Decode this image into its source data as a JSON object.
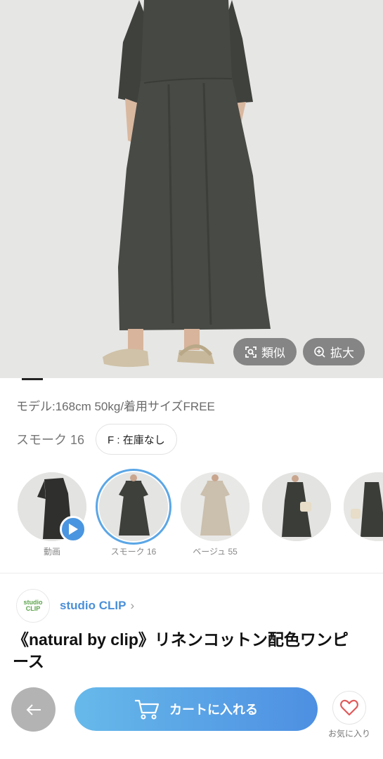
{
  "hero": {
    "similar_label": "類似",
    "zoom_label": "拡大"
  },
  "model_info": "モデル:168cm 50kg/着用サイズFREE",
  "color": {
    "name": "スモーク 16",
    "size_stock": "F : 在庫なし"
  },
  "thumbnails": [
    {
      "caption": "動画",
      "icon": "play-icon"
    },
    {
      "caption": "スモーク 16",
      "selected": true
    },
    {
      "caption": "ベージュ 55"
    },
    {
      "caption": ""
    },
    {
      "caption": ""
    }
  ],
  "shop": {
    "logo_text": "studio CLIP",
    "name": "studio CLIP",
    "chevron": "›"
  },
  "product": {
    "title": "《natural by clip》リネンコットン配色ワンピース"
  },
  "bottom_bar": {
    "back_icon": "arrow-left-icon",
    "cart_label": "カートに入れる",
    "cart_icon": "cart-icon",
    "favorite_label": "お気に入り",
    "favorite_icon": "heart-icon"
  },
  "colors": {
    "accent_blue": "#4a8fd8",
    "cart_gradient_start": "#67b9ea",
    "cart_gradient_end": "#4d8fe2",
    "heart_red": "#e05a5a"
  }
}
